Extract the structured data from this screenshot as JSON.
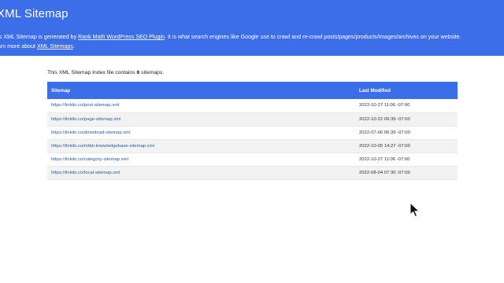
{
  "header": {
    "title": "XML Sitemap",
    "desc_line1_prefix": "This XML Sitemap is generated by ",
    "desc_link1": "Rank Math WordPress SEO Plugin",
    "desc_line1_suffix": ". It is what search engines like Google use to crawl and re-crawl posts/pages/products/images/archives on your website.",
    "desc_line2_prefix": "Learn more about ",
    "desc_link2": "XML Sitemaps",
    "desc_line2_suffix": "."
  },
  "summary": {
    "prefix": "This XML Sitemap Index file contains ",
    "count": "6",
    "suffix": " sitemaps."
  },
  "table": {
    "col_sitemap": "Sitemap",
    "col_modified": "Last Modified",
    "rows": [
      {
        "url": "https://linkilo.co/post-sitemap.xml",
        "modified": "2022-10-27 11:06 -07:00"
      },
      {
        "url": "https://linkilo.co/page-sitemap.xml",
        "modified": "2022-10-22 09:39 -07:00"
      },
      {
        "url": "https://linkilo.co/download-sitemap.xml",
        "modified": "2022-07-06 06:39 -07:00"
      },
      {
        "url": "https://linkilo.co/mtkb-knowledgebase-sitemap.xml",
        "modified": "2022-10-05 14:27 -07:00"
      },
      {
        "url": "https://linkilo.co/category-sitemap.xml",
        "modified": "2022-10-27 11:06 -07:00"
      },
      {
        "url": "https://linkilo.co/local-sitemap.xml",
        "modified": "2022-08-04 07:30 -07:00"
      }
    ]
  },
  "colors": {
    "header_bg": "#3b6ee8",
    "link": "#2460a0",
    "row_alt": "#f2f2f2"
  },
  "icons": {
    "cursor": "mouse-pointer-icon"
  }
}
